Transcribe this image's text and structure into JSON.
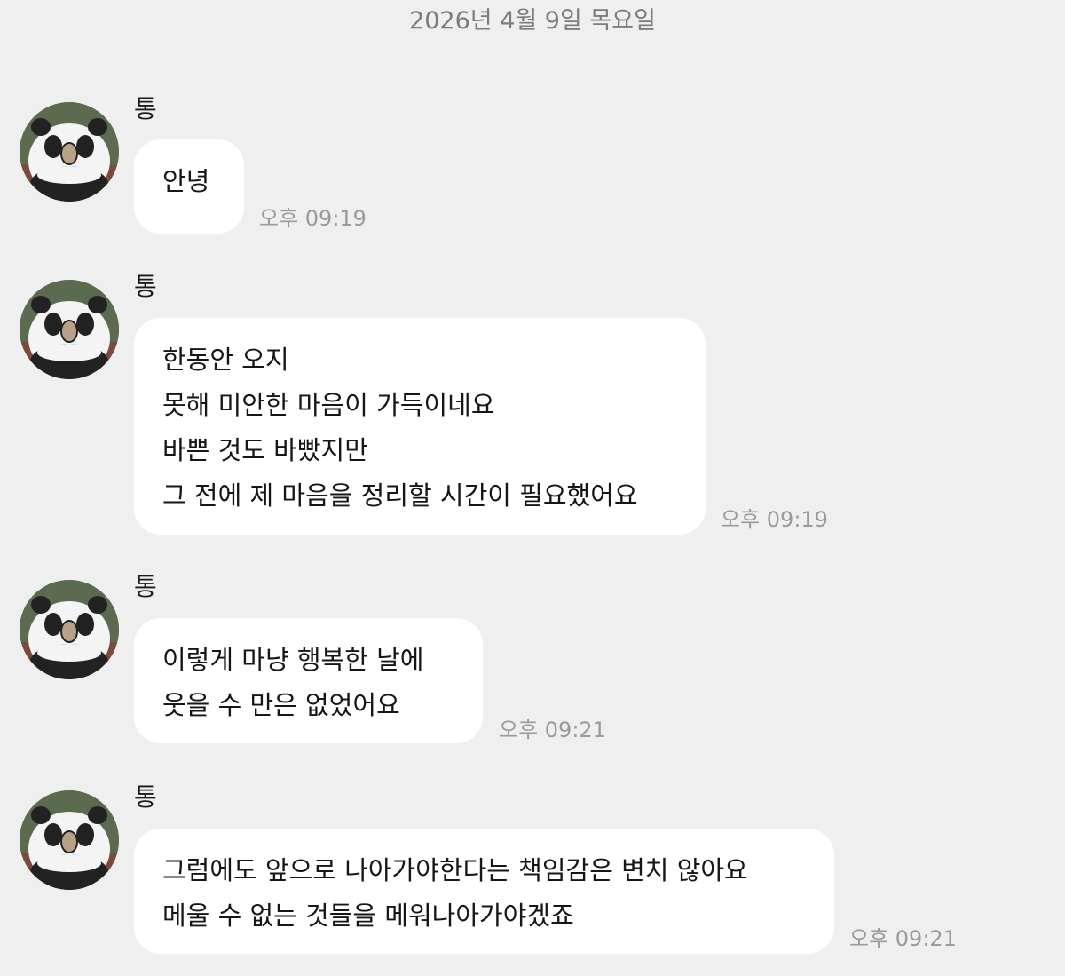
{
  "date_divider": "2026년 4월 9일 목요일",
  "messages": [
    {
      "sender": "통",
      "lines": [
        "안녕"
      ],
      "time": "오후 09:19"
    },
    {
      "sender": "통",
      "lines": [
        "한동안 오지",
        "못해 미안한 마음이 가득이네요",
        "바쁜 것도 바빴지만",
        "그 전에 제 마음을 정리할 시간이 필요했어요"
      ],
      "time": "오후 09:19"
    },
    {
      "sender": "통",
      "lines": [
        "이렇게 마냥 행복한 날에",
        "웃을 수 만은 없었어요"
      ],
      "time": "오후 09:21"
    },
    {
      "sender": "통",
      "lines": [
        "그럼에도 앞으로 나아가야한다는 책임감은 변치 않아요",
        "메울 수 없는 것들을 메워나아가야겠죠"
      ],
      "time": "오후 09:21"
    }
  ]
}
